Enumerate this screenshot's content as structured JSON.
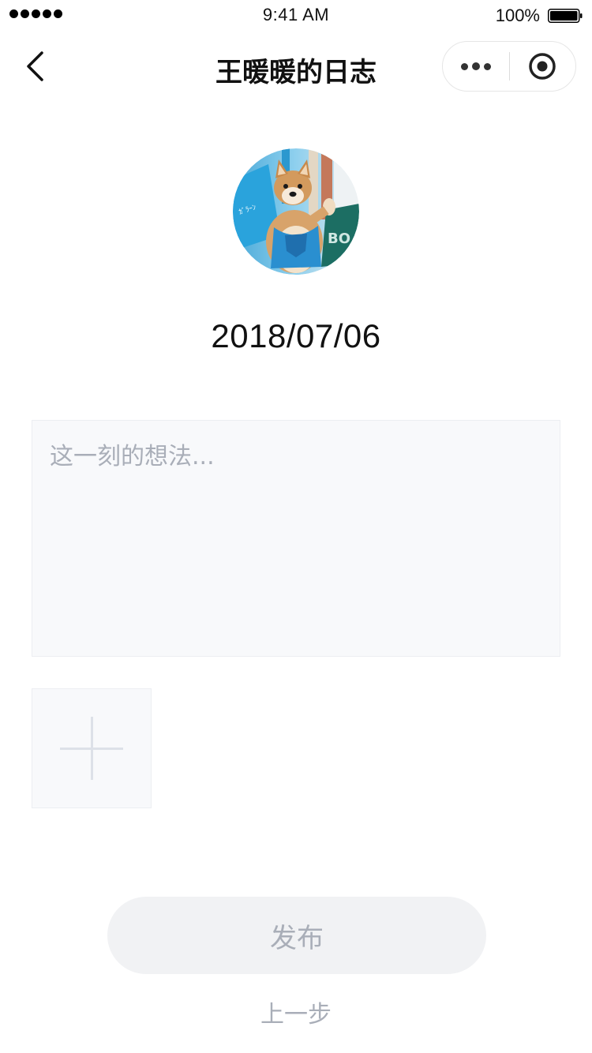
{
  "status_bar": {
    "time": "9:41 AM",
    "battery_percent": "100%",
    "signal_icon": "signal-dots-icon",
    "battery_icon": "battery-icon"
  },
  "nav": {
    "title": "王暖暖的日志",
    "back_icon": "chevron-left-icon",
    "more_icon": "more-dots-icon",
    "close_icon": "target-circle-icon"
  },
  "entry": {
    "date": "2018/07/06",
    "avatar_icon": "shiba-dog-avatar",
    "thought_placeholder": "这一刻的想法...",
    "add_photo_icon": "plus-icon"
  },
  "actions": {
    "publish_label": "发布",
    "previous_label": "上一步"
  },
  "colors": {
    "placeholder": "#a9aeb8",
    "box_bg": "#f8f9fb",
    "button_bg": "#f1f2f4"
  }
}
